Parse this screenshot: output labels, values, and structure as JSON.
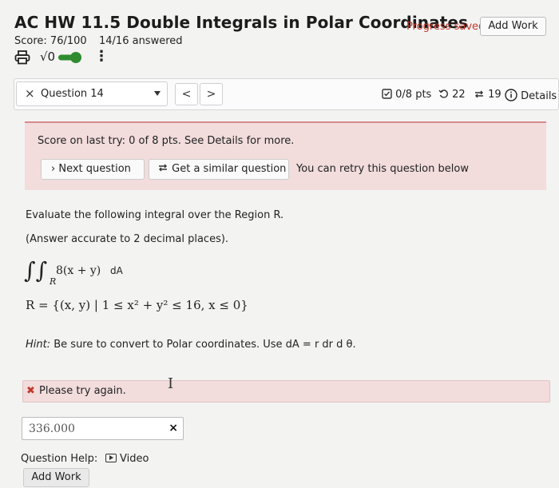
{
  "header": {
    "title": "AC HW 11.5 Double Integrals in Polar Coordinates",
    "progress_status": "Progress saved",
    "add_work_label": "Add Work",
    "score": "Score: 76/100",
    "answered": "14/16 answered"
  },
  "toolbar": {
    "print_icon": "printer-icon",
    "math_icon_text": "√0",
    "toggle_state": "on",
    "more_icon": "more-vertical-icon"
  },
  "question_bar": {
    "close_glyph": "×",
    "selected_question": "Question 14",
    "prev_glyph": "<",
    "next_glyph": ">",
    "points": "0/8 pts",
    "tries_remaining": "22",
    "retries": "19",
    "details_label": "Details"
  },
  "feedback": {
    "last_try": "Score on last try: 0 of 8 pts. See Details for more.",
    "next_question_label": "Next question",
    "similar_question_label": "Get a similar question",
    "retry_text": "You can retry this question below"
  },
  "question": {
    "prompt_line1": "Evaluate the following integral over the Region R.",
    "prompt_line2": "(Answer accurate to 2 decimal places).",
    "integrand": "8(x + y)",
    "differential": "dA",
    "region_label": "R",
    "region": "R = {(x, y) | 1 ≤ x² + y² ≤ 16, x ≤ 0}",
    "hint_label": "Hint:",
    "hint_text": "Be sure to convert to Polar coordinates. Use dA = r dr d θ."
  },
  "result": {
    "message": "Please try again.",
    "answer_value": "336.000",
    "wrong_mark": "×"
  },
  "help": {
    "label": "Question Help:",
    "video_label": "Video",
    "add_work_label": "Add Work"
  },
  "colors": {
    "error_red": "#c0392b",
    "feedback_bg": "#f2dcdc",
    "toggle_green": "#2e8b2e"
  }
}
